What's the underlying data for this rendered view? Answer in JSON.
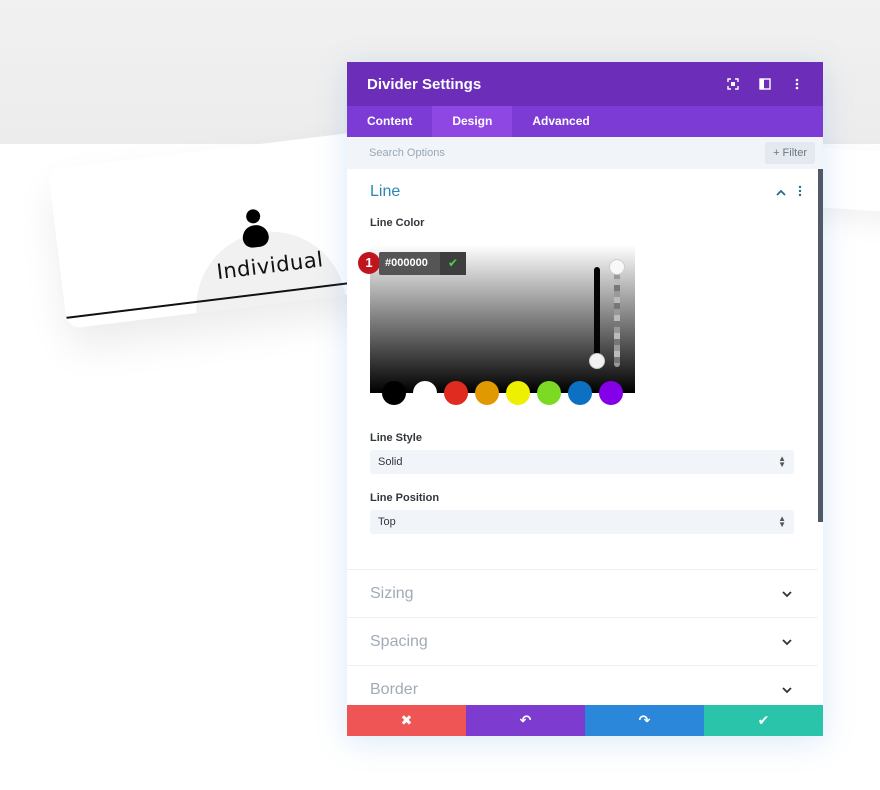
{
  "preview": {
    "card_label": "Individual"
  },
  "modal": {
    "title": "Divider Settings",
    "header_icons": [
      "focus-icon",
      "split-view-icon",
      "more-vertical-icon"
    ],
    "tabs": [
      {
        "label": "Content",
        "active": false
      },
      {
        "label": "Design",
        "active": true
      },
      {
        "label": "Advanced",
        "active": false
      }
    ],
    "search": {
      "placeholder": "Search Options",
      "filter_label": "+ Filter"
    },
    "line_section": {
      "title": "Line",
      "line_color_label": "Line Color",
      "color_picker": {
        "hex_value": "#000000",
        "badge_number": "1",
        "confirm_icon": "✔",
        "swatches": [
          "#000000",
          "#ffffff",
          "#e02b20",
          "#e09900",
          "#edf000",
          "#7cda24",
          "#0c71c3",
          "#8300e9"
        ]
      },
      "line_style_label": "Line Style",
      "line_style_value": "Solid",
      "line_position_label": "Line Position",
      "line_position_value": "Top"
    },
    "collapsed_sections": [
      "Sizing",
      "Spacing",
      "Border"
    ],
    "footer": {
      "cancel_icon": "✖",
      "undo_icon": "↶",
      "redo_icon": "↷",
      "save_icon": "✔",
      "colors": {
        "cancel": "#ef5555",
        "undo": "#7d3bcf",
        "redo": "#2b87da",
        "save": "#29c4a9"
      }
    }
  }
}
